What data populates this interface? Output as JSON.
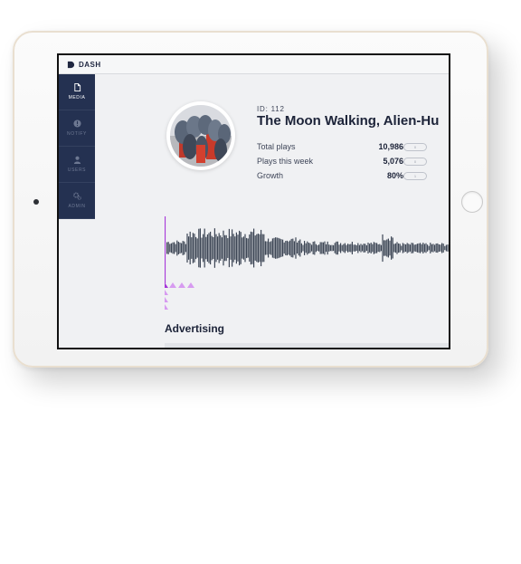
{
  "app": {
    "brand": "DASH"
  },
  "sidebar": {
    "items": [
      {
        "label": "MEDIA",
        "icon": "document-icon",
        "active": true
      },
      {
        "label": "NOTIFY",
        "icon": "alert-icon",
        "active": false
      },
      {
        "label": "USERS",
        "icon": "user-icon",
        "active": false
      },
      {
        "label": "ADMIN",
        "icon": "gears-icon",
        "active": false
      }
    ]
  },
  "track": {
    "id_label": "ID: 112",
    "title": "The Moon Walking, Alien-Hu",
    "stats": [
      {
        "label": "Total plays",
        "value": "10,986",
        "pill": "0"
      },
      {
        "label": "Plays this week",
        "value": "5,076",
        "pill": "0"
      },
      {
        "label": "Growth",
        "value": "80%",
        "pill": "1"
      }
    ]
  },
  "section": {
    "title": "Advertising"
  },
  "colors": {
    "sidebar": "#243151",
    "playhead": "#a637d9",
    "marker": "#d79bf0",
    "waveform": "#3d4655"
  }
}
